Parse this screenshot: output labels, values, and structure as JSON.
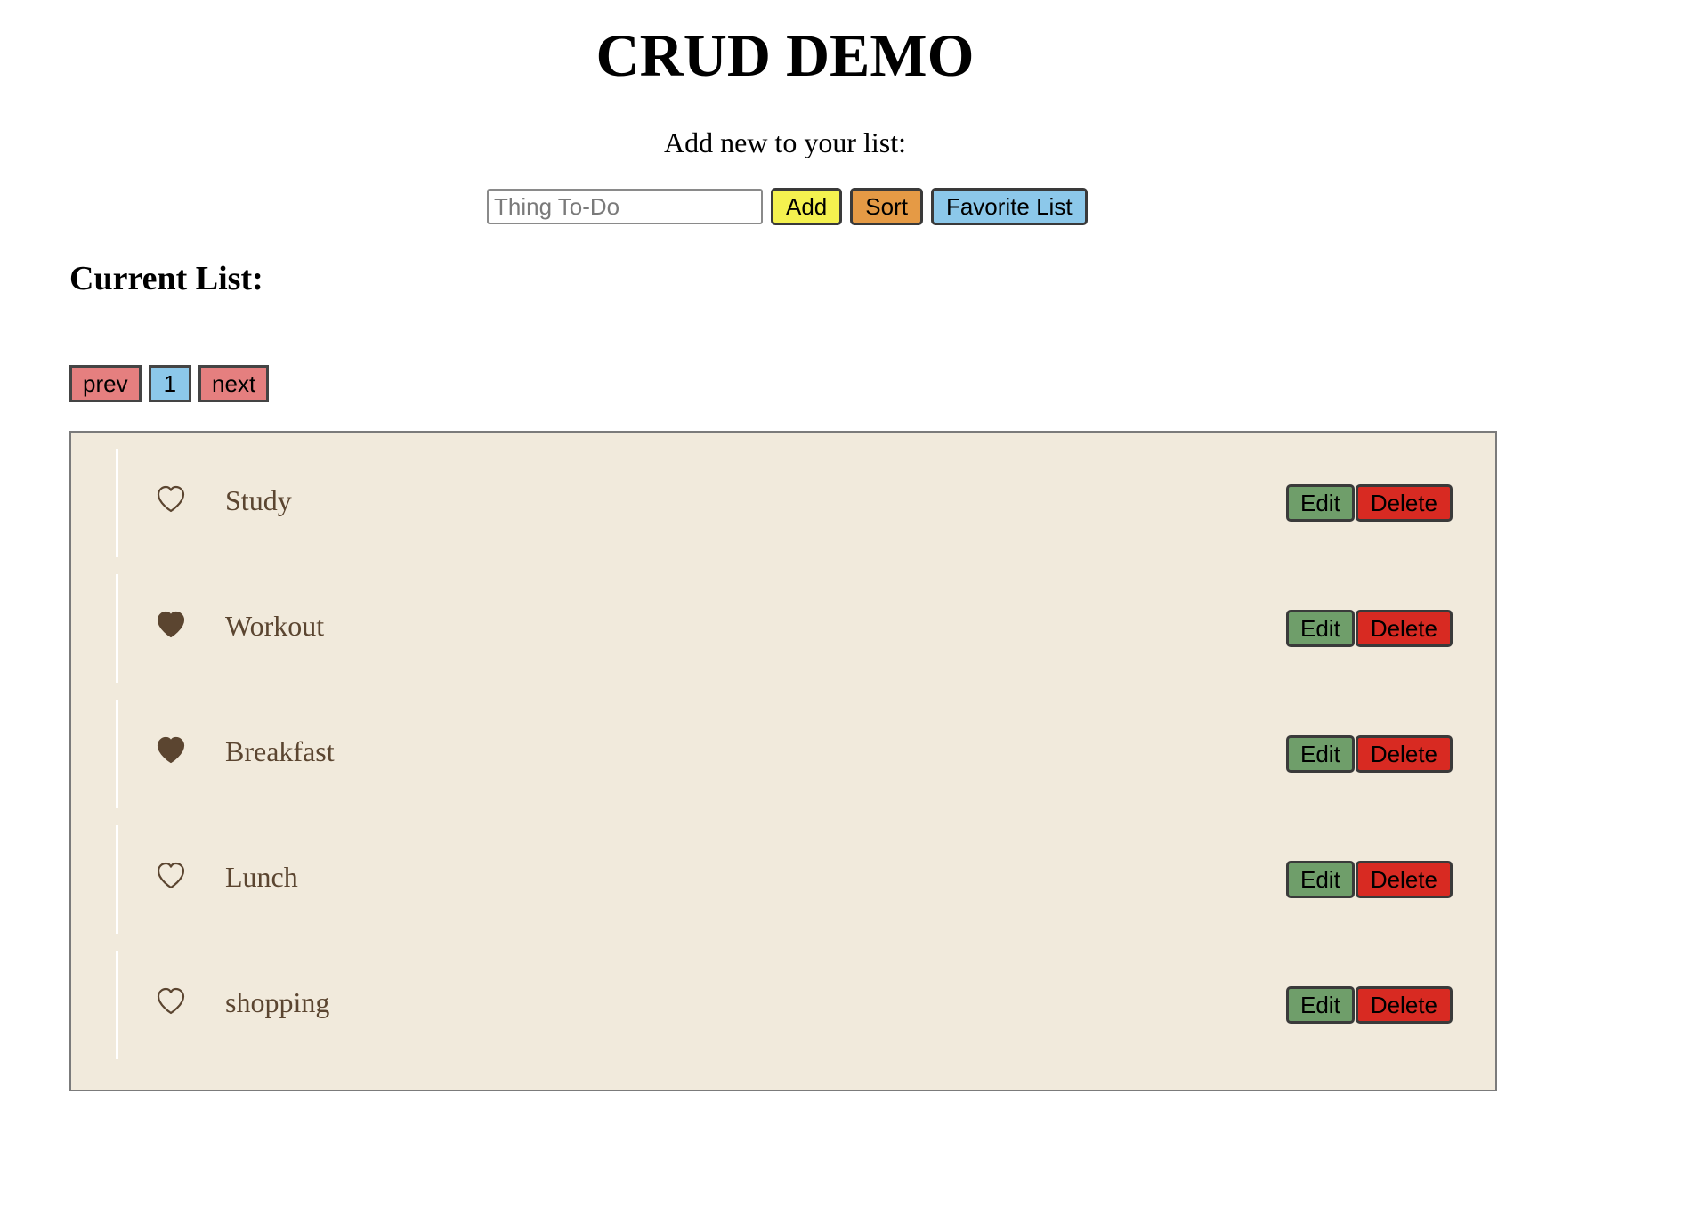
{
  "header": {
    "title": "CRUD DEMO",
    "subtitle": "Add new to your list:"
  },
  "add_form": {
    "input_value": "",
    "input_placeholder": "Thing To-Do",
    "add_label": "Add",
    "sort_label": "Sort",
    "favorite_label": "Favorite List"
  },
  "current_list_label": "Current List:",
  "pagination": {
    "prev_label": "prev",
    "page_label": "1",
    "next_label": "next"
  },
  "list": {
    "items": [
      {
        "text": "Study",
        "favorite": false,
        "edit_label": "Edit",
        "delete_label": "Delete"
      },
      {
        "text": "Workout",
        "favorite": true,
        "edit_label": "Edit",
        "delete_label": "Delete"
      },
      {
        "text": "Breakfast",
        "favorite": true,
        "edit_label": "Edit",
        "delete_label": "Delete"
      },
      {
        "text": "Lunch",
        "favorite": false,
        "edit_label": "Edit",
        "delete_label": "Delete"
      },
      {
        "text": "shopping",
        "favorite": false,
        "edit_label": "Edit",
        "delete_label": "Delete"
      }
    ]
  },
  "colors": {
    "list_background": "#f1eadc",
    "item_text": "#5b4530",
    "heart": "#5b4530",
    "add_button": "#f4f14f",
    "sort_button": "#e59a45",
    "favorite_button": "#8cc8ea",
    "pager_nav": "#e57f7f",
    "pager_page": "#8cc8ea",
    "edit_button": "#6f9e6a",
    "delete_button": "#d82a22"
  },
  "icons": {
    "favorite_on": "heart-filled-icon",
    "favorite_off": "heart-outline-icon"
  }
}
